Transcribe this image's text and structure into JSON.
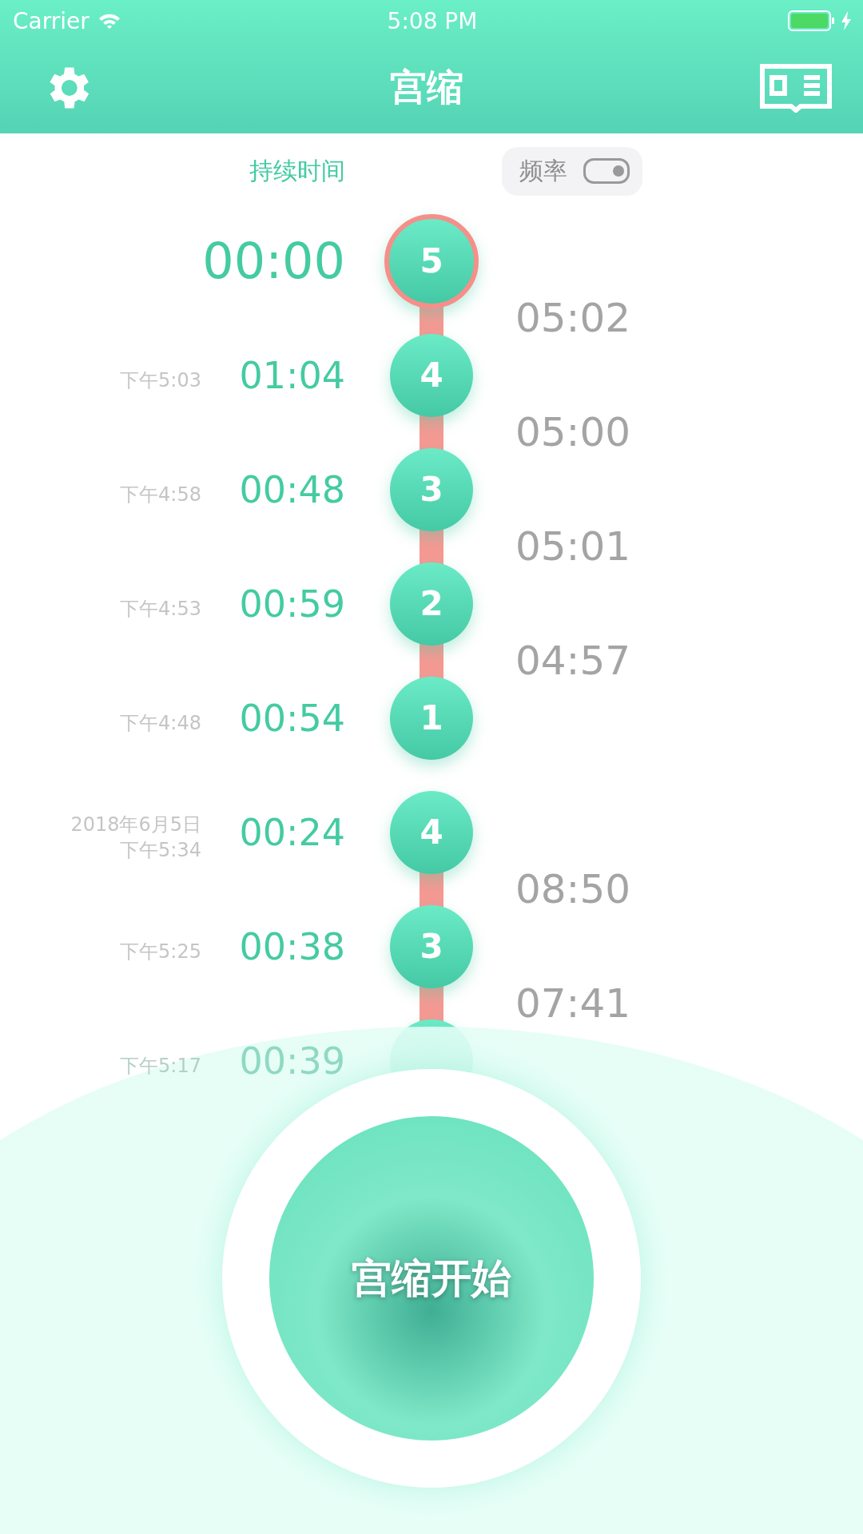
{
  "status_bar": {
    "carrier": "Carrier",
    "time": "5:08 PM"
  },
  "nav": {
    "title": "宫缩"
  },
  "header": {
    "duration_label": "持续时间",
    "frequency_label": "频率",
    "frequency_on": false
  },
  "entries": [
    {
      "kind": "current",
      "duration": "00:00",
      "number": "5",
      "linked": true,
      "interval": "05:02"
    },
    {
      "kind": "record",
      "dates": [
        "下午5:03"
      ],
      "duration": "01:04",
      "number": "4",
      "linked": true,
      "interval": "05:00"
    },
    {
      "kind": "record",
      "dates": [
        "下午4:58"
      ],
      "duration": "00:48",
      "number": "3",
      "linked": true,
      "interval": "05:01"
    },
    {
      "kind": "record",
      "dates": [
        "下午4:53"
      ],
      "duration": "00:59",
      "number": "2",
      "linked": true,
      "interval": "04:57"
    },
    {
      "kind": "record",
      "dates": [
        "下午4:48"
      ],
      "duration": "00:54",
      "number": "1",
      "linked": false
    },
    {
      "kind": "record",
      "dates": [
        "2018年6月5日",
        "下午5:34"
      ],
      "duration": "00:24",
      "number": "4",
      "linked": true,
      "interval": "08:50"
    },
    {
      "kind": "record",
      "dates": [
        "下午5:25"
      ],
      "duration": "00:38",
      "number": "3",
      "linked": true,
      "interval": "07:41",
      "faded": false
    },
    {
      "kind": "record",
      "dates": [
        "下午5:17"
      ],
      "duration": "00:39",
      "linked": false,
      "faded": true
    }
  ],
  "start_button": {
    "label": "宫缩开始"
  }
}
